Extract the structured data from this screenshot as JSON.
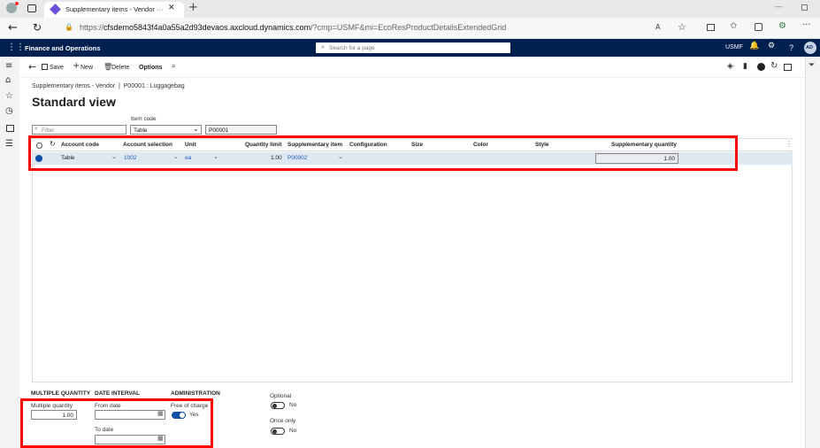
{
  "browser": {
    "tab_title": "Supplementary items - Vendor ···",
    "url_prefix": "https://",
    "url_host": "cfsdemo5843f4a0a55a2d93devaos.axcloud.dynamics.com",
    "url_path": "/?cmp=USMF&mi=EcoResProductDetailsExtendedGrid"
  },
  "app": {
    "title": "Finance and Operations",
    "search_placeholder": "Search for a page",
    "company": "USMF",
    "avatar_initials": "AD",
    "help": "?"
  },
  "toolbar": {
    "save": "Save",
    "new": "New",
    "delete": "Delete",
    "options": "Options"
  },
  "page": {
    "breadcrumb": "Supplementary items - Vendor  |  P00001 : Luggagebag",
    "view_title": "Standard view",
    "filter_placeholder": "Filter",
    "item_code_label": "Item code",
    "item_code_value": "Table",
    "item_value": "P00001"
  },
  "grid": {
    "columns": [
      "Account code",
      "Account selection",
      "Unit",
      "Quantity limit",
      "Supplementary item",
      "Configuration",
      "Size",
      "Color",
      "Style",
      "Supplementary quantity"
    ],
    "rows": [
      {
        "account_code": "Table",
        "account_selection": "1002",
        "unit": "ea",
        "quantity_limit": "1.00",
        "supplementary_item": "P00002",
        "configuration": "",
        "size": "",
        "color": "",
        "style": "",
        "supplementary_quantity": "1.00"
      }
    ]
  },
  "details": {
    "multiple_quantity_header": "MULTIPLE QUANTITY",
    "multiple_quantity_label": "Multiple quantity",
    "multiple_quantity_value": "1.00",
    "date_interval_header": "DATE INTERVAL",
    "from_date_label": "From date",
    "from_date_value": "",
    "to_date_label": "To date",
    "to_date_value": "",
    "administration_header": "ADMINISTRATION",
    "free_of_charge_label": "Free of charge",
    "free_of_charge_value": "Yes",
    "optional_label": "Optional",
    "optional_value": "No",
    "once_only_label": "Once only",
    "once_only_value": "No"
  },
  "colors": {
    "app_bar": "#002050",
    "accent": "#0f4fa8",
    "highlight": "#ff0000",
    "row_selected": "#dfe7f0"
  }
}
